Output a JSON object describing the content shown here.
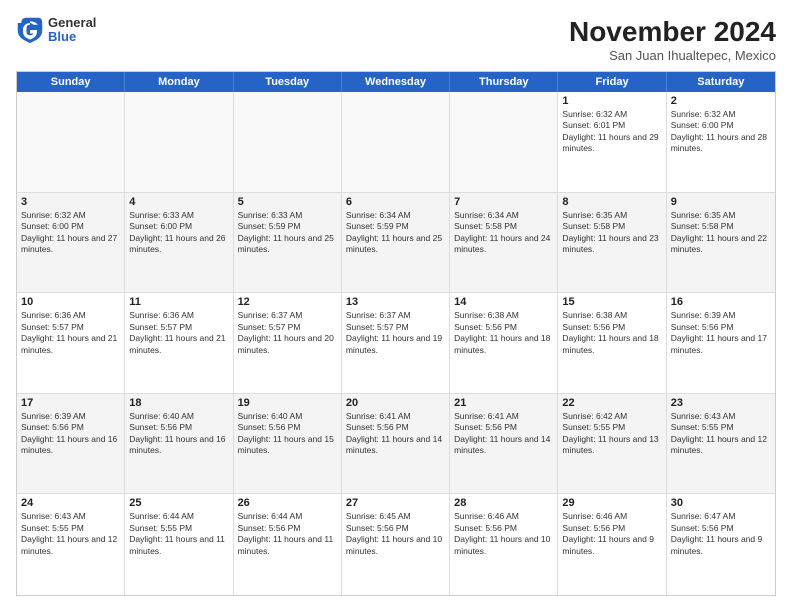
{
  "header": {
    "logo": {
      "general": "General",
      "blue": "Blue"
    },
    "title": "November 2024",
    "location": "San Juan Ihualtepec, Mexico"
  },
  "weekdays": [
    "Sunday",
    "Monday",
    "Tuesday",
    "Wednesday",
    "Thursday",
    "Friday",
    "Saturday"
  ],
  "rows": [
    [
      {
        "day": "",
        "info": ""
      },
      {
        "day": "",
        "info": ""
      },
      {
        "day": "",
        "info": ""
      },
      {
        "day": "",
        "info": ""
      },
      {
        "day": "",
        "info": ""
      },
      {
        "day": "1",
        "info": "Sunrise: 6:32 AM\nSunset: 6:01 PM\nDaylight: 11 hours and 29 minutes."
      },
      {
        "day": "2",
        "info": "Sunrise: 6:32 AM\nSunset: 6:00 PM\nDaylight: 11 hours and 28 minutes."
      }
    ],
    [
      {
        "day": "3",
        "info": "Sunrise: 6:32 AM\nSunset: 6:00 PM\nDaylight: 11 hours and 27 minutes."
      },
      {
        "day": "4",
        "info": "Sunrise: 6:33 AM\nSunset: 6:00 PM\nDaylight: 11 hours and 26 minutes."
      },
      {
        "day": "5",
        "info": "Sunrise: 6:33 AM\nSunset: 5:59 PM\nDaylight: 11 hours and 25 minutes."
      },
      {
        "day": "6",
        "info": "Sunrise: 6:34 AM\nSunset: 5:59 PM\nDaylight: 11 hours and 25 minutes."
      },
      {
        "day": "7",
        "info": "Sunrise: 6:34 AM\nSunset: 5:58 PM\nDaylight: 11 hours and 24 minutes."
      },
      {
        "day": "8",
        "info": "Sunrise: 6:35 AM\nSunset: 5:58 PM\nDaylight: 11 hours and 23 minutes."
      },
      {
        "day": "9",
        "info": "Sunrise: 6:35 AM\nSunset: 5:58 PM\nDaylight: 11 hours and 22 minutes."
      }
    ],
    [
      {
        "day": "10",
        "info": "Sunrise: 6:36 AM\nSunset: 5:57 PM\nDaylight: 11 hours and 21 minutes."
      },
      {
        "day": "11",
        "info": "Sunrise: 6:36 AM\nSunset: 5:57 PM\nDaylight: 11 hours and 21 minutes."
      },
      {
        "day": "12",
        "info": "Sunrise: 6:37 AM\nSunset: 5:57 PM\nDaylight: 11 hours and 20 minutes."
      },
      {
        "day": "13",
        "info": "Sunrise: 6:37 AM\nSunset: 5:57 PM\nDaylight: 11 hours and 19 minutes."
      },
      {
        "day": "14",
        "info": "Sunrise: 6:38 AM\nSunset: 5:56 PM\nDaylight: 11 hours and 18 minutes."
      },
      {
        "day": "15",
        "info": "Sunrise: 6:38 AM\nSunset: 5:56 PM\nDaylight: 11 hours and 18 minutes."
      },
      {
        "day": "16",
        "info": "Sunrise: 6:39 AM\nSunset: 5:56 PM\nDaylight: 11 hours and 17 minutes."
      }
    ],
    [
      {
        "day": "17",
        "info": "Sunrise: 6:39 AM\nSunset: 5:56 PM\nDaylight: 11 hours and 16 minutes."
      },
      {
        "day": "18",
        "info": "Sunrise: 6:40 AM\nSunset: 5:56 PM\nDaylight: 11 hours and 16 minutes."
      },
      {
        "day": "19",
        "info": "Sunrise: 6:40 AM\nSunset: 5:56 PM\nDaylight: 11 hours and 15 minutes."
      },
      {
        "day": "20",
        "info": "Sunrise: 6:41 AM\nSunset: 5:56 PM\nDaylight: 11 hours and 14 minutes."
      },
      {
        "day": "21",
        "info": "Sunrise: 6:41 AM\nSunset: 5:56 PM\nDaylight: 11 hours and 14 minutes."
      },
      {
        "day": "22",
        "info": "Sunrise: 6:42 AM\nSunset: 5:55 PM\nDaylight: 11 hours and 13 minutes."
      },
      {
        "day": "23",
        "info": "Sunrise: 6:43 AM\nSunset: 5:55 PM\nDaylight: 11 hours and 12 minutes."
      }
    ],
    [
      {
        "day": "24",
        "info": "Sunrise: 6:43 AM\nSunset: 5:55 PM\nDaylight: 11 hours and 12 minutes."
      },
      {
        "day": "25",
        "info": "Sunrise: 6:44 AM\nSunset: 5:55 PM\nDaylight: 11 hours and 11 minutes."
      },
      {
        "day": "26",
        "info": "Sunrise: 6:44 AM\nSunset: 5:56 PM\nDaylight: 11 hours and 11 minutes."
      },
      {
        "day": "27",
        "info": "Sunrise: 6:45 AM\nSunset: 5:56 PM\nDaylight: 11 hours and 10 minutes."
      },
      {
        "day": "28",
        "info": "Sunrise: 6:46 AM\nSunset: 5:56 PM\nDaylight: 11 hours and 10 minutes."
      },
      {
        "day": "29",
        "info": "Sunrise: 6:46 AM\nSunset: 5:56 PM\nDaylight: 11 hours and 9 minutes."
      },
      {
        "day": "30",
        "info": "Sunrise: 6:47 AM\nSunset: 5:56 PM\nDaylight: 11 hours and 9 minutes."
      }
    ]
  ]
}
